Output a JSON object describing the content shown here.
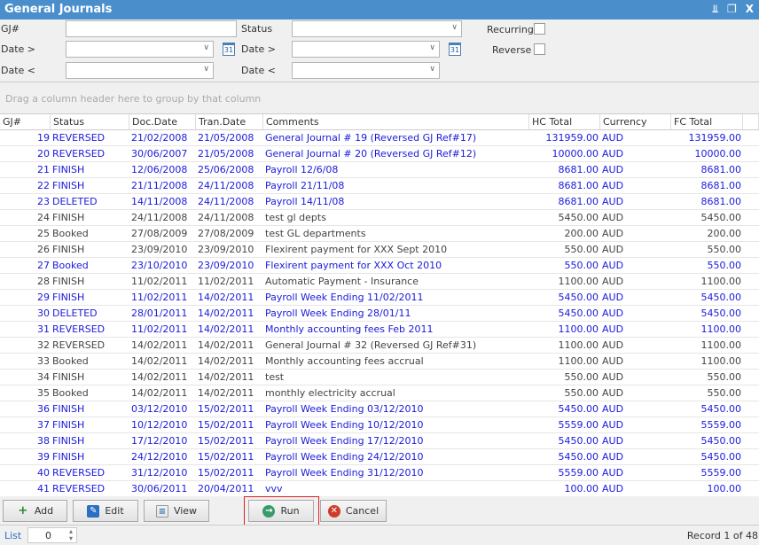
{
  "window": {
    "title": "General Journals",
    "controls": [
      "pin-icon",
      "restore-icon",
      "close-icon"
    ]
  },
  "filters": {
    "gj_label": "GJ#",
    "gj_value": "",
    "status_label": "Status",
    "status_value": "",
    "date_gt_label": "Date >",
    "date_lt_label": "Date <",
    "date_gt2_label": "Date >",
    "date_lt2_label": "Date <",
    "recurring_label": "Recurring",
    "reverse_label": "Reverse",
    "recurring_checked": false,
    "reverse_checked": false,
    "calendar_text": "31"
  },
  "group_panel": "Drag a column header here to group by that column",
  "grid": {
    "columns": [
      "GJ#",
      "Status",
      "Doc.Date",
      "Tran.Date",
      "Comments",
      "HC Total",
      "Currency",
      "FC Total",
      ""
    ],
    "rows": [
      [
        "19",
        "REVERSED",
        "21/02/2008",
        "21/05/2008",
        "General Journal # 19 (Reversed GJ Ref#17)",
        "131959.00",
        "AUD",
        "131959.00",
        "blue"
      ],
      [
        "20",
        "REVERSED",
        "30/06/2007",
        "21/05/2008",
        "General Journal # 20 (Reversed GJ Ref#12)",
        "10000.00",
        "AUD",
        "10000.00",
        "blue"
      ],
      [
        "21",
        "FINISH",
        "12/06/2008",
        "25/06/2008",
        "Payroll 12/6/08",
        "8681.00",
        "AUD",
        "8681.00",
        "blue"
      ],
      [
        "22",
        "FINISH",
        "21/11/2008",
        "24/11/2008",
        "Payroll 21/11/08",
        "8681.00",
        "AUD",
        "8681.00",
        "blue"
      ],
      [
        "23",
        "DELETED",
        "14/11/2008",
        "24/11/2008",
        "Payroll 14/11/08",
        "8681.00",
        "AUD",
        "8681.00",
        "blue"
      ],
      [
        "24",
        "FINISH",
        "24/11/2008",
        "24/11/2008",
        "test gl depts",
        "5450.00",
        "AUD",
        "5450.00",
        "dark"
      ],
      [
        "25",
        "Booked",
        "27/08/2009",
        "27/08/2009",
        "test GL departments",
        "200.00",
        "AUD",
        "200.00",
        "dark"
      ],
      [
        "26",
        "FINISH",
        "23/09/2010",
        "23/09/2010",
        "Flexirent payment for XXX Sept 2010",
        "550.00",
        "AUD",
        "550.00",
        "dark"
      ],
      [
        "27",
        "Booked",
        "23/10/2010",
        "23/09/2010",
        "Flexirent payment for XXX Oct 2010",
        "550.00",
        "AUD",
        "550.00",
        "blue"
      ],
      [
        "28",
        "FINISH",
        "11/02/2011",
        "11/02/2011",
        "Automatic Payment - Insurance",
        "1100.00",
        "AUD",
        "1100.00",
        "dark"
      ],
      [
        "29",
        "FINISH",
        "11/02/2011",
        "14/02/2011",
        "Payroll Week Ending 11/02/2011",
        "5450.00",
        "AUD",
        "5450.00",
        "blue"
      ],
      [
        "30",
        "DELETED",
        "28/01/2011",
        "14/02/2011",
        "Payroll Week Ending 28/01/11",
        "5450.00",
        "AUD",
        "5450.00",
        "blue"
      ],
      [
        "31",
        "REVERSED",
        "11/02/2011",
        "14/02/2011",
        "Monthly accounting fees Feb 2011",
        "1100.00",
        "AUD",
        "1100.00",
        "blue"
      ],
      [
        "32",
        "REVERSED",
        "14/02/2011",
        "14/02/2011",
        "General Journal # 32 (Reversed GJ Ref#31)",
        "1100.00",
        "AUD",
        "1100.00",
        "dark"
      ],
      [
        "33",
        "Booked",
        "14/02/2011",
        "14/02/2011",
        "Monthly accounting fees accrual",
        "1100.00",
        "AUD",
        "1100.00",
        "dark"
      ],
      [
        "34",
        "FINISH",
        "14/02/2011",
        "14/02/2011",
        "test",
        "550.00",
        "AUD",
        "550.00",
        "dark"
      ],
      [
        "35",
        "Booked",
        "14/02/2011",
        "14/02/2011",
        "monthly electricity accrual",
        "550.00",
        "AUD",
        "550.00",
        "dark"
      ],
      [
        "36",
        "FINISH",
        "03/12/2010",
        "15/02/2011",
        "Payroll Week Ending 03/12/2010",
        "5450.00",
        "AUD",
        "5450.00",
        "blue"
      ],
      [
        "37",
        "FINISH",
        "10/12/2010",
        "15/02/2011",
        "Payroll Week Ending 10/12/2010",
        "5559.00",
        "AUD",
        "5559.00",
        "blue"
      ],
      [
        "38",
        "FINISH",
        "17/12/2010",
        "15/02/2011",
        "Payroll Week Ending 17/12/2010",
        "5450.00",
        "AUD",
        "5450.00",
        "blue"
      ],
      [
        "39",
        "FINISH",
        "24/12/2010",
        "15/02/2011",
        "Payroll Week Ending 24/12/2010",
        "5450.00",
        "AUD",
        "5450.00",
        "blue"
      ],
      [
        "40",
        "REVERSED",
        "31/12/2010",
        "15/02/2011",
        "Payroll Week Ending 31/12/2010",
        "5559.00",
        "AUD",
        "5559.00",
        "blue"
      ],
      [
        "41",
        "REVERSED",
        "30/06/2011",
        "20/04/2011",
        "vvv",
        "100.00",
        "AUD",
        "100.00",
        "blue"
      ]
    ]
  },
  "buttons": {
    "add": "Add",
    "edit": "Edit",
    "view": "View",
    "run": "Run",
    "cancel": "Cancel"
  },
  "status": {
    "list_label": "List",
    "spinner_value": "0",
    "record_text": "Record 1 of 48"
  },
  "colors": {
    "title_bar": "#4a8fcc",
    "row_blue": "#1a1adc",
    "highlight": "#e02020"
  }
}
